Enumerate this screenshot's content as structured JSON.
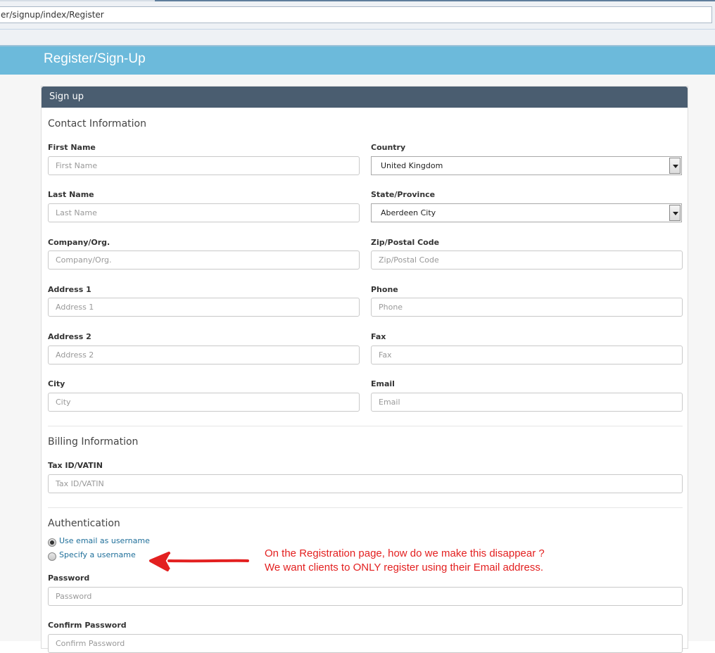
{
  "browser": {
    "url": "er/signup/index/Register"
  },
  "header": {
    "title": "Register/Sign-Up"
  },
  "panel": {
    "heading": "Sign up"
  },
  "contact": {
    "title": "Contact Information",
    "first_name": {
      "label": "First Name",
      "placeholder": "First Name"
    },
    "last_name": {
      "label": "Last Name",
      "placeholder": "Last Name"
    },
    "company": {
      "label": "Company/Org.",
      "placeholder": "Company/Org."
    },
    "address1": {
      "label": "Address 1",
      "placeholder": "Address 1"
    },
    "address2": {
      "label": "Address 2",
      "placeholder": "Address 2"
    },
    "city": {
      "label": "City",
      "placeholder": "City"
    },
    "country": {
      "label": "Country",
      "value": "United Kingdom"
    },
    "state": {
      "label": "State/Province",
      "value": "Aberdeen City"
    },
    "zip": {
      "label": "Zip/Postal Code",
      "placeholder": "Zip/Postal Code"
    },
    "phone": {
      "label": "Phone",
      "placeholder": "Phone"
    },
    "fax": {
      "label": "Fax",
      "placeholder": "Fax"
    },
    "email": {
      "label": "Email",
      "placeholder": "Email"
    }
  },
  "billing": {
    "title": "Billing Information",
    "tax": {
      "label": "Tax ID/VATIN",
      "placeholder": "Tax ID/VATIN"
    }
  },
  "auth": {
    "title": "Authentication",
    "option_email": "Use email as username",
    "option_username": "Specify a username",
    "selected": "option_email",
    "password": {
      "label": "Password",
      "placeholder": "Password"
    },
    "confirm": {
      "label": "Confirm Password",
      "placeholder": "Confirm Password"
    }
  },
  "annotation": {
    "line1": "On the Registration page, how do we make this disappear ?",
    "line2": "We want clients to ONLY register using their Email address.",
    "color": "#e32020"
  },
  "colors": {
    "header": "#6cbadb",
    "panel_heading": "#4a5d70",
    "link": "#1f6f9a"
  }
}
